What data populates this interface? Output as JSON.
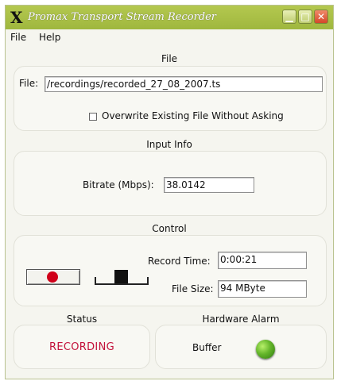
{
  "window": {
    "title": "Promax Transport Stream Recorder"
  },
  "menu": {
    "file": "File",
    "help": "Help"
  },
  "file_section": {
    "title": "File",
    "file_label": "File:",
    "file_value": "/recordings/recorded_27_08_2007.ts",
    "overwrite_label": "Overwrite Existing File Without Asking",
    "overwrite_checked": false
  },
  "input_info": {
    "title": "Input Info",
    "bitrate_label": "Bitrate (Mbps):",
    "bitrate_value": "38.0142"
  },
  "control": {
    "title": "Control",
    "record_time_label": "Record Time:",
    "record_time_value": "0:00:21",
    "file_size_label": "File Size:",
    "file_size_value": "94 MByte"
  },
  "status": {
    "title": "Status",
    "value": "RECORDING",
    "color": "#c3123b"
  },
  "hardware_alarm": {
    "title": "Hardware Alarm",
    "buffer_label": "Buffer",
    "led_color": "#64b52a"
  }
}
